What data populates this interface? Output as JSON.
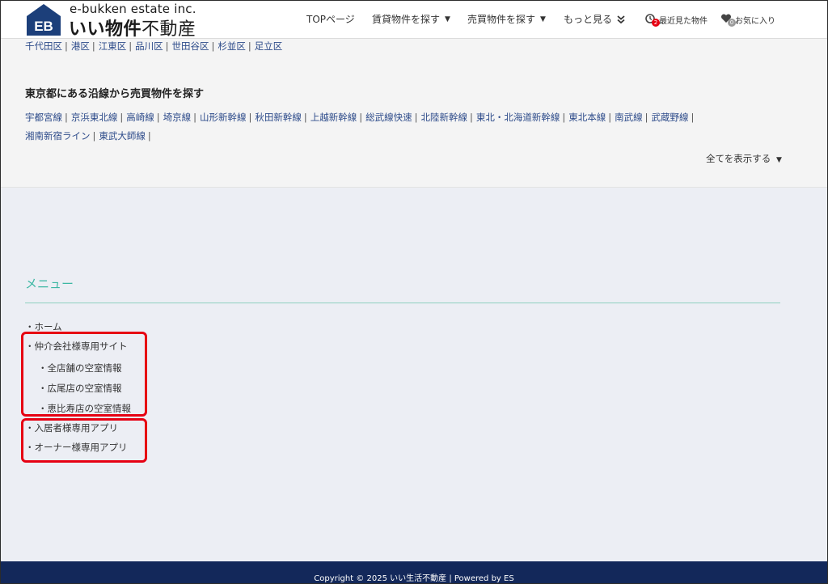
{
  "header": {
    "logo_mark": "EB",
    "logo_sub": "e-bukken estate inc.",
    "logo_main_bold": "いい物件",
    "logo_main_regular": "不動産",
    "nav": {
      "top": "TOPページ",
      "rent": "賃貸物件を探す",
      "sale": "売買物件を探す",
      "more": "もっと見る",
      "recent": "最近見た物件",
      "recent_count": "2",
      "favorites": "お気に入り",
      "favorites_count": "0"
    }
  },
  "wards": [
    "千代田区",
    "港区",
    "江東区",
    "品川区",
    "世田谷区",
    "杉並区",
    "足立区"
  ],
  "lines_heading": "東京都にある沿線から売買物件を探す",
  "lines_row1": [
    "宇都宮線",
    "京浜東北線",
    "高崎線",
    "埼京線",
    "山形新幹線",
    "秋田新幹線",
    "上越新幹線",
    "総武線快速",
    "北陸新幹線",
    "東北・北海道新幹線",
    "東北本線",
    "南武線",
    "武蔵野線"
  ],
  "lines_row2": [
    "湘南新宿ライン",
    "東武大師線"
  ],
  "show_all": "全てを表示する",
  "menu": {
    "title": "メニュー",
    "items": {
      "home": "・ホーム",
      "agent_site": "・仲介会社様専用サイト",
      "all_stores": "・全店舗の空室情報",
      "hiroo": "・広尾店の空室情報",
      "ebisu": "・恵比寿店の空室情報",
      "resident_app": "・入居者様専用アプリ",
      "owner_app": "・オーナー様専用アプリ"
    }
  },
  "footer": {
    "copyright": "Copyright © 2025 いい生活不動産 | Powered by ES"
  },
  "colors": {
    "accent": "#3db7a3",
    "link": "#2d4b8a",
    "footer_bg": "#13285a",
    "highlight": "#e60012",
    "logo": "#1c3f7a"
  }
}
